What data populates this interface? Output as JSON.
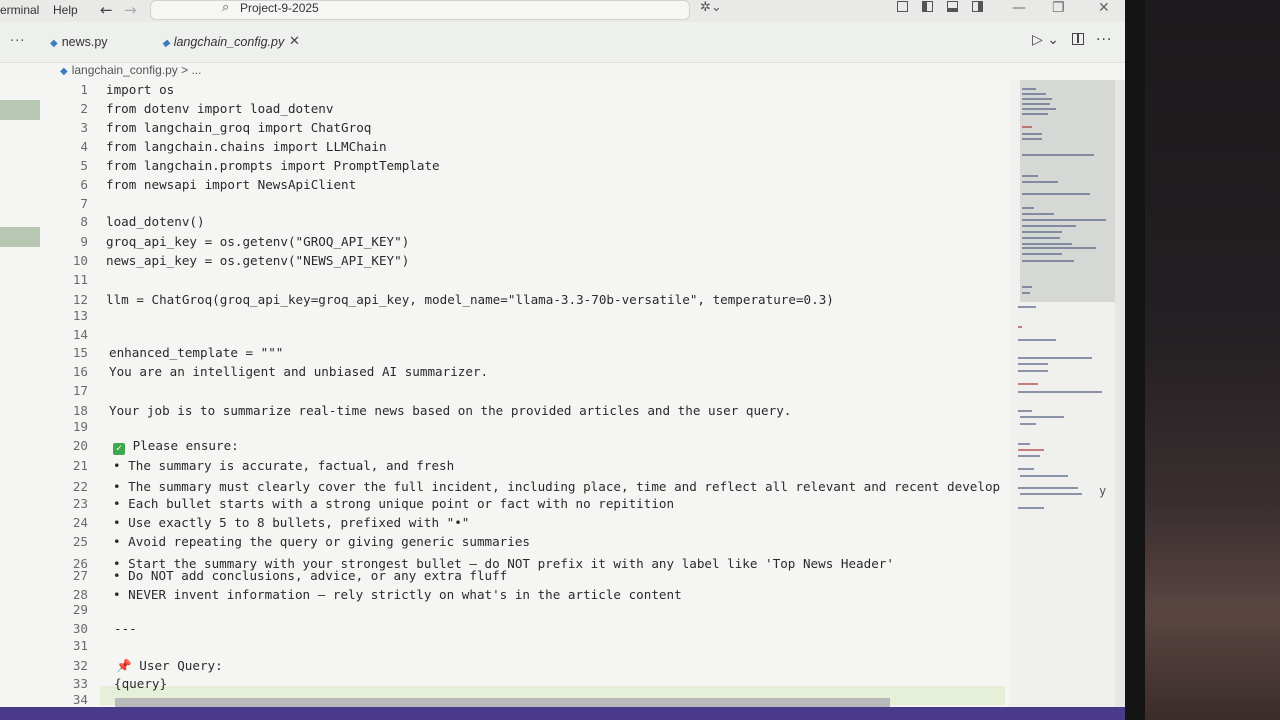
{
  "menu": {
    "terminal": "erminal",
    "help": "Help"
  },
  "search": {
    "text": "Project-9-2025"
  },
  "tabs": [
    {
      "label": "news.py"
    },
    {
      "label": "langchain_config.py"
    }
  ],
  "breadcrumb": {
    "text": "langchain_config.py > ..."
  },
  "icons": {
    "back": "back-arrow-icon",
    "forward": "forward-arrow-icon",
    "run": "run-icon",
    "close": "close-icon"
  },
  "colors": {
    "python_icon": "#3b7bbf",
    "check": "#3ea84e",
    "status_bar": "#4a3a8a"
  },
  "editor": {
    "lines": [
      {
        "n": "1",
        "t": "import os"
      },
      {
        "n": "2",
        "t": "from dotenv import load_dotenv"
      },
      {
        "n": "3",
        "t": "from langchain_groq import ChatGroq"
      },
      {
        "n": "4",
        "t": "from langchain.chains import LLMChain"
      },
      {
        "n": "5",
        "t": "from langchain.prompts import PromptTemplate"
      },
      {
        "n": "6",
        "t": "from newsapi import NewsApiClient"
      },
      {
        "n": "7",
        "t": ""
      },
      {
        "n": "8",
        "t": "load_dotenv()"
      },
      {
        "n": "9",
        "t": "groq_api_key = os.getenv(\"GROQ_API_KEY\")"
      },
      {
        "n": "10",
        "t": "news_api_key = os.getenv(\"NEWS_API_KEY\")"
      },
      {
        "n": "11",
        "t": ""
      },
      {
        "n": "12",
        "t": "llm = ChatGroq(groq_api_key=groq_api_key, model_name=\"llama-3.3-70b-versatile\", temperature=0.3)"
      },
      {
        "n": "13",
        "t": ""
      },
      {
        "n": "14",
        "t": ""
      },
      {
        "n": "15",
        "t": "enhanced_template = \"\"\""
      },
      {
        "n": "16",
        "t": "You are an intelligent and unbiased AI summarizer."
      },
      {
        "n": "17",
        "t": ""
      },
      {
        "n": "18",
        "t": "Your job is to summarize real-time news based on the provided articles and the user query."
      },
      {
        "n": "19",
        "t": ""
      },
      {
        "n": "20",
        "t": "Please ensure:"
      },
      {
        "n": "21",
        "t": "• The summary is accurate, factual, and fresh"
      },
      {
        "n": "22",
        "t": "• The summary must clearly cover the full incident, including place, time and reflect all relevant and recent develop"
      },
      {
        "n": "23",
        "t": "• Each bullet starts with a strong unique point or fact with no repitition"
      },
      {
        "n": "24",
        "t": "• Use exactly 5 to 8 bullets, prefixed with \"•\""
      },
      {
        "n": "25",
        "t": "• Avoid repeating the query or giving generic summaries"
      },
      {
        "n": "26",
        "t": "• Start the summary with your strongest bullet — do NOT prefix it with any label like 'Top News Header'"
      },
      {
        "n": "27",
        "t": "• Do NOT add conclusions, advice, or any extra fluff"
      },
      {
        "n": "28",
        "t": "• NEVER invent information — rely strictly on what's in the article content"
      },
      {
        "n": "29",
        "t": ""
      },
      {
        "n": "30",
        "t": "---"
      },
      {
        "n": "31",
        "t": ""
      },
      {
        "n": "32",
        "t": "User Query:"
      },
      {
        "n": "33",
        "t": "{query}"
      },
      {
        "n": "34",
        "t": ""
      }
    ],
    "overflow_tail": "y"
  }
}
